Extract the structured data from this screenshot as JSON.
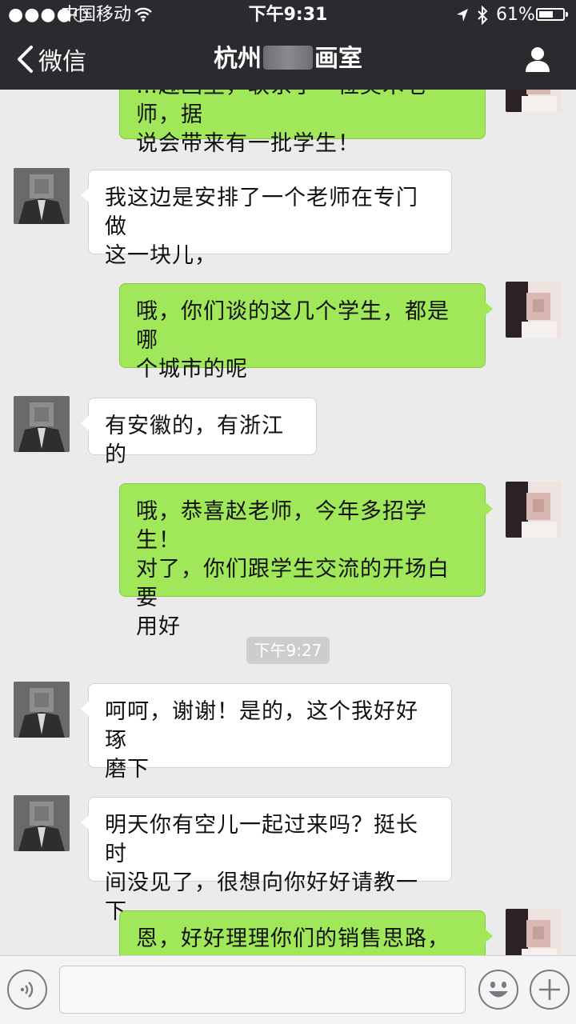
{
  "status_bar": {
    "signal": "●●●●○",
    "carrier": "中国移动",
    "time": "下午9:31",
    "battery_percent": "61%",
    "battery_level": 0.61,
    "icons": [
      "wifi-icon",
      "location-arrow-icon",
      "bluetooth-icon",
      "battery-icon"
    ]
  },
  "nav": {
    "back_label": "微信",
    "title_prefix": "杭州",
    "title_suffix": "画室",
    "back_icon": "chevron-left-icon",
    "profile_icon": "person-icon"
  },
  "messages": [
    {
      "side": "right",
      "lines": [
        "…趣画室，联系了一位美术老师，据",
        "说会带来有一批学生！"
      ],
      "avatar": "female"
    },
    {
      "side": "left",
      "lines": [
        "我这边是安排了一个老师在专门做",
        "这一块儿，"
      ],
      "avatar": "male"
    },
    {
      "side": "right",
      "lines": [
        "哦，你们谈的这几个学生，都是哪",
        "个城市的呢"
      ],
      "avatar": "female"
    },
    {
      "side": "left",
      "lines": [
        "有安徽的，有浙江的"
      ],
      "avatar": "male"
    },
    {
      "side": "right",
      "lines": [
        "哦，恭喜赵老师，今年多招学生！",
        "对了，你们跟学生交流的开场白要",
        "用好"
      ],
      "avatar": "female"
    },
    {
      "side": "left",
      "lines": [
        "呵呵，谢谢！是的，这个我好好琢",
        "磨下"
      ],
      "avatar": "male"
    },
    {
      "side": "left",
      "lines": [
        "明天你有空儿一起过来吗？挺长时",
        "间没见了，很想向你好好请教一下"
      ],
      "avatar": "male"
    },
    {
      "side": "right",
      "lines": [
        "恩，好好理理你们的销售思路，反"
      ],
      "avatar": "female"
    }
  ],
  "timestamp": "下午9:27",
  "input_bar": {
    "icons": [
      "voice-icon",
      "emoji-icon",
      "plus-icon"
    ],
    "value": ""
  },
  "colors": {
    "top_bar": "#2b2b2f",
    "background": "#ebebeb",
    "sent_bubble": "#a0e759",
    "received_bubble": "#ffffff"
  }
}
